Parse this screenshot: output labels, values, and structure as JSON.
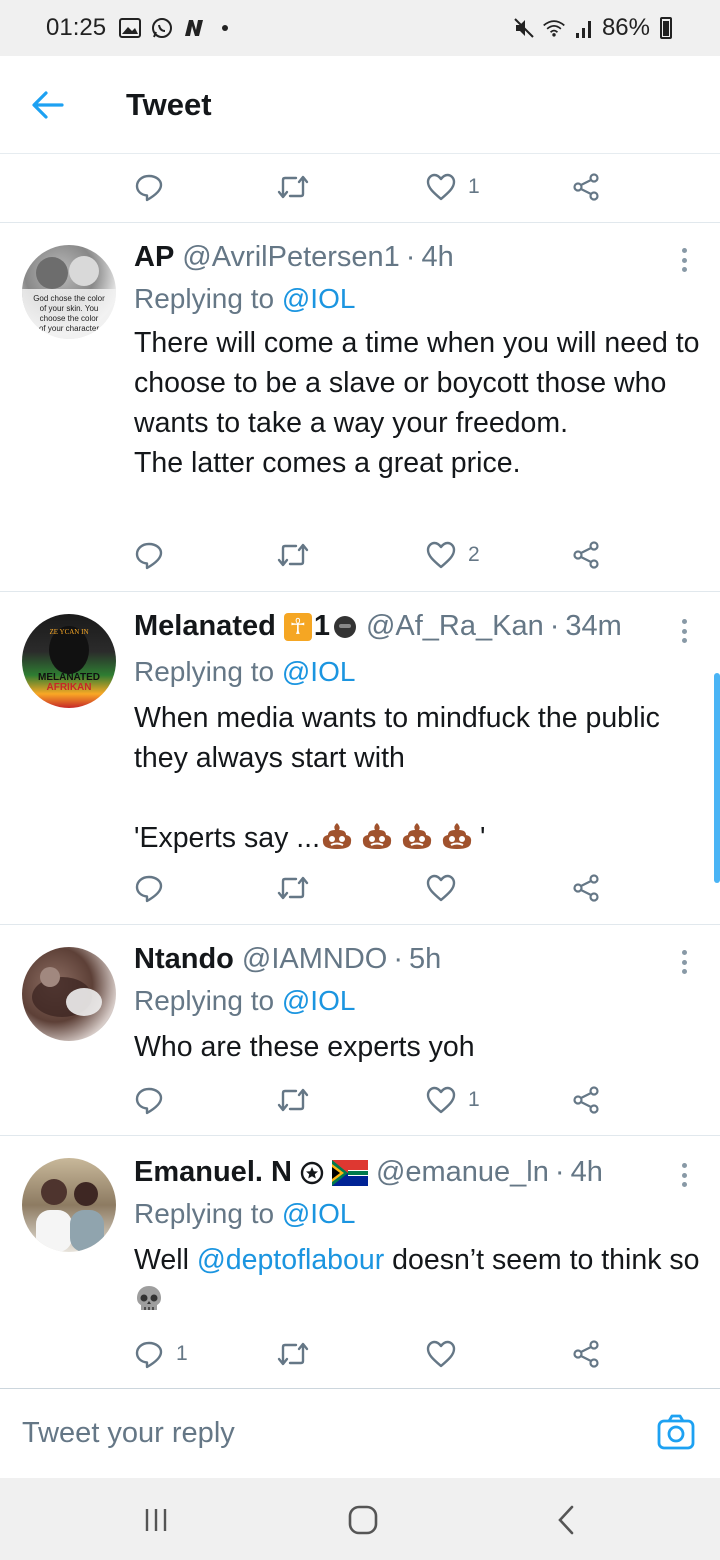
{
  "status_bar": {
    "time": "01:25",
    "battery": "86%"
  },
  "header": {
    "title": "Tweet"
  },
  "top_actions": {
    "likes": "1"
  },
  "tweets": [
    {
      "name": "AP",
      "handle": "@AvrilPetersen1",
      "time": "4h",
      "replying_prefix": "Replying to ",
      "replying_to": "@IOL",
      "text": "There will come a time when you will need to choose to be a slave or boycott those who wants to take a way your freedom.\nThe latter comes a great price.",
      "avatar_text": "God chose the color of your skin. You choose the color of your character",
      "replies": "",
      "likes": "2"
    },
    {
      "name": "Melanated",
      "badges": "☥1",
      "handle": "@Af_Ra_Kan",
      "time": "34m",
      "replying_prefix": "Replying to ",
      "replying_to": "@IOL",
      "text": "When media wants to mindfuck the public they always start with\n\n'Experts say ...",
      "text_end": "'",
      "avatar_text_top": "ZE YCAN IN",
      "avatar_text_mid": "MELANATED",
      "avatar_text_bot": "AFRIKAN",
      "replies": "",
      "likes": ""
    },
    {
      "name": "Ntando",
      "handle": "@IAMNDO",
      "time": "5h",
      "replying_prefix": "Replying to ",
      "replying_to": "@IOL",
      "text": "Who are these experts yoh",
      "replies": "",
      "likes": "1"
    },
    {
      "name": "Emanuel. N",
      "handle": "@emanue_ln",
      "time": "4h",
      "replying_prefix": "Replying to ",
      "replying_to": "@IOL",
      "text_pre": "Well ",
      "text_mention": "@deptoflabour",
      "text_post": " doesn’t seem to think so ",
      "replies": "1",
      "likes": ""
    }
  ],
  "reply_bar": {
    "placeholder": "Tweet your reply"
  },
  "colors": {
    "accent": "#1da1f2",
    "mention": "#1b95e0",
    "secondary_text": "#657786",
    "divider": "#e1e8ed"
  }
}
